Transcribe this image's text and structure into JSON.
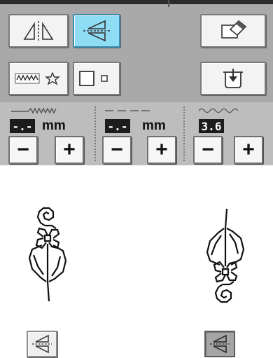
{
  "panel": {
    "mirror_vertical_icon": "mirror-vertical-icon",
    "mirror_horizontal_icon": "mirror-horizontal-icon",
    "pattern_select_icon": "stitch-pattern-star-icon",
    "size_toggle_icon": "size-large-small-icon",
    "eraser_icon": "eraser-icon",
    "memory_pocket_icon": "memory-pocket-icon"
  },
  "settings": {
    "width": {
      "value": "-.-",
      "unit": "mm",
      "icon": "zigzag-width-icon"
    },
    "length": {
      "value": "-.-",
      "unit": "mm",
      "icon": "stitch-length-icon"
    },
    "density": {
      "value": "3.6",
      "icon": "satin-density-icon"
    },
    "minus_label": "−",
    "plus_label": "+"
  },
  "preview": {
    "left_pattern_icon": "flower-vine-pattern-icon",
    "right_pattern_icon": "flower-vine-pattern-mirrored-icon",
    "left_button_icon": "mirror-horizontal-icon",
    "right_button_icon": "mirror-horizontal-icon"
  },
  "colors": {
    "active_button": "#8fdcf5",
    "panel_gray": "#bfbfbf",
    "value_box": "#1c1c1c"
  }
}
